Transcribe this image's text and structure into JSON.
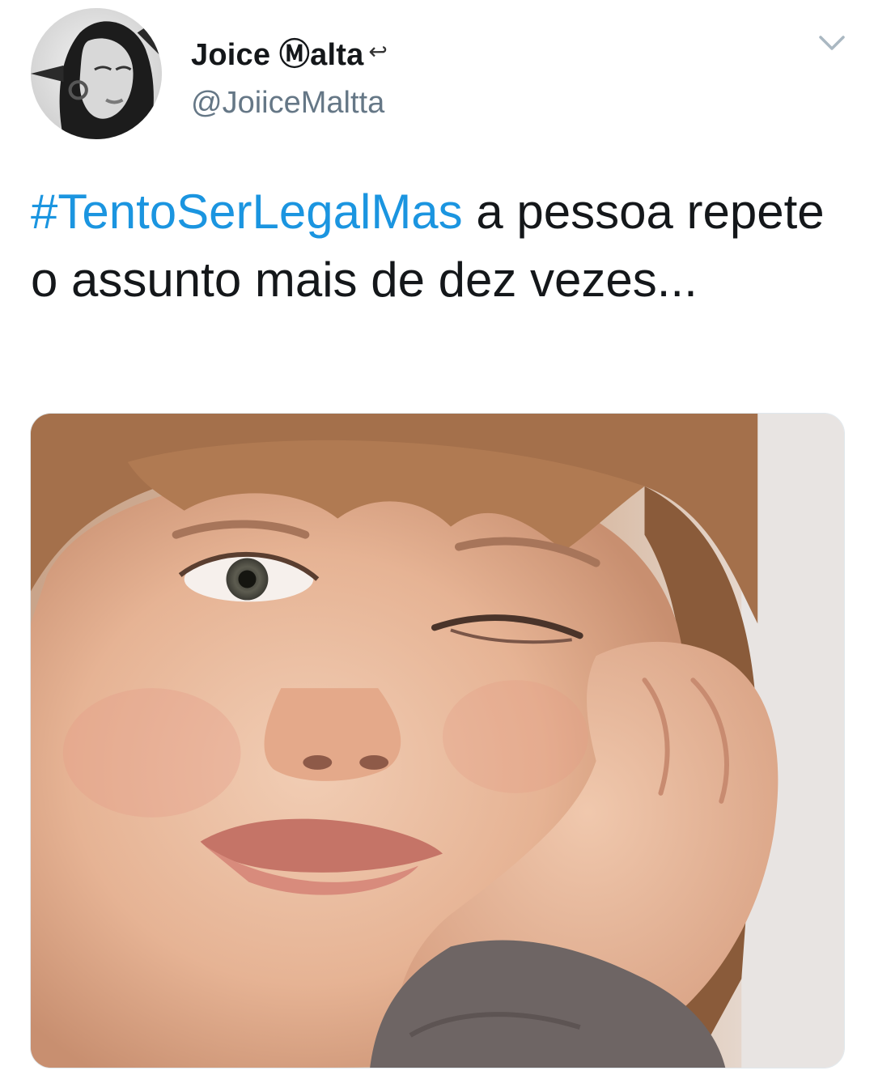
{
  "tweet": {
    "display_name": "Joice Ⓜalta",
    "name_emoji": "↩",
    "handle": "@JoiiceMaltta",
    "text": {
      "hashtag": "#TentoSerLegalMas",
      "body": " a pessoa repete o assunto mais de dez vezes..."
    }
  },
  "icons": {
    "menu": "chevron-down-icon",
    "avatar": "profile-photo",
    "media": "photo-bored-child"
  },
  "colors": {
    "hashtag": "#1b95e0",
    "handle": "#657786",
    "text": "#14171a",
    "chevron": "#aab8c2"
  }
}
